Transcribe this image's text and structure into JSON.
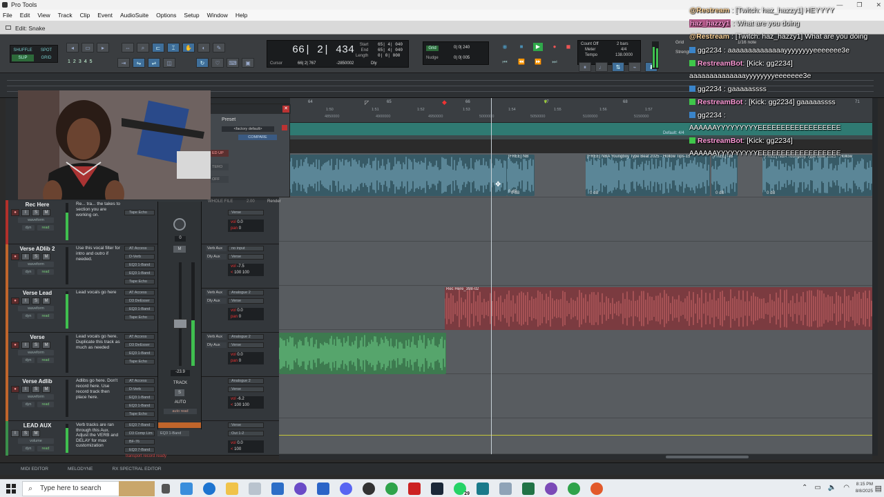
{
  "window": {
    "title": "Pro Tools",
    "controls": [
      "—",
      "❐",
      "✕"
    ]
  },
  "menu": [
    "File",
    "Edit",
    "View",
    "Track",
    "Clip",
    "Event",
    "AudioSuite",
    "Options",
    "Setup",
    "Window",
    "Help"
  ],
  "edit_window": {
    "title": "Edit: Snake"
  },
  "toolbar": {
    "modes": {
      "shuffle": "SHUFFLE",
      "spot": "SPOT",
      "slip": "SLIP",
      "grid": "GRID"
    },
    "zoom_presets": [
      "1",
      "2",
      "3",
      "4",
      "5"
    ],
    "counter": {
      "main": "66| 2| 434",
      "labels": [
        "Start",
        "End",
        "Length"
      ],
      "start": "65| 4| 040",
      "end": "65| 4| 040",
      "length": "0| 0| 000",
      "cursor_label": "Cursor",
      "cursor_value": "66| 2| 767",
      "sample_value": "-2850002",
      "dly": "Dly"
    },
    "grid": {
      "label": "Grid",
      "value": "0| 0| 240",
      "nudge_label": "Nudge",
      "nudge_value": "0| 0| 005"
    },
    "meter": {
      "count_off": "Count Off",
      "meter_label": "Meter",
      "tempo_label": "Tempo",
      "bars": "2 bars",
      "meter": "4/4",
      "tempo": "138.0000"
    },
    "grid_right": "Grid",
    "grid_right2": "Strengt",
    "note_value": "1/16 note"
  },
  "ruler": {
    "bars": [
      "64",
      "65",
      "66",
      "67",
      "68",
      "71"
    ],
    "times": [
      "1:50",
      "1:51",
      "1:52",
      "1:53",
      "1:54",
      "1:55",
      "1:56",
      "1:57"
    ],
    "samples": [
      "4850000",
      "4900000",
      "4950000",
      "5000000",
      "5050000",
      "5100000",
      "5150000"
    ],
    "meter_default": "Default: 4/4"
  },
  "preset": {
    "title": "Preset",
    "factory": "<factory default>",
    "compare": "COMPARE",
    "buttons": [
      "ED UP",
      "TERO",
      "OFF"
    ],
    "whole_file": "WHOLE FILE",
    "value": "2.00",
    "render": "Render"
  },
  "clips": {
    "top_1": "[FREE] NB",
    "top_2": "[FREE] NBA Youngboy Type Beat 2025 - Hollow Tips-15",
    "top_3": "[FREE] NB",
    "top_4": "[FREE] NBA Youngboy Type Beat 2025 - Hollow",
    "db": "0 dB",
    "rec_here": "Rec Here_398-02"
  },
  "tracks": [
    {
      "name": "Rec Here",
      "mode": "waveform",
      "comment": "Re... tra... the takes to section you are working on.",
      "inserts": [
        "Tape Echo"
      ],
      "io": [
        "Verse"
      ],
      "vol": "0.0",
      "pan": "0",
      "color": "#c0392b"
    },
    {
      "name": "Verse ADlib 2",
      "mode": "waveform",
      "comment": "Use this vocal filter for intro and outro if needed.",
      "inserts": [
        "AT Access",
        "D-Verb",
        "EQ3 1-Band",
        "EQ3 1-Band",
        "Tape Echo"
      ],
      "io": [
        "no input",
        "Verse"
      ],
      "vol": "-7.5",
      "pan": "100",
      "pan2": "100",
      "color": "#c0652b"
    },
    {
      "name": "Verse Lead",
      "mode": "waveform",
      "comment": "Lead vocals go here",
      "inserts": [
        "AT Access",
        "D3 DeEsser",
        "EQ3 1-Band",
        "Tape Echo"
      ],
      "io": [
        "Analogue 2",
        "Verse"
      ],
      "vol": "0.0",
      "pan": "0",
      "color": "#c0652b"
    },
    {
      "name": "Verse",
      "mode": "waveform",
      "comment": "Lead vocals go here. Duplicate this track as much as needed",
      "inserts": [
        "AT Access",
        "D3 DeEsser",
        "EQ3 1-Band",
        "Tape Echo"
      ],
      "io": [
        "Analogue 2",
        "Verse"
      ],
      "vol": "0.0",
      "pan": "0",
      "color": "#c0652b"
    },
    {
      "name": "Verse Adlib",
      "mode": "waveform",
      "comment": "Adlibs go here. Don't record here. Use record track then place here.",
      "inserts": [
        "AT Access",
        "D-Verb",
        "EQ3 1-Band",
        "EQ3 1-Band",
        "Tape Echo"
      ],
      "io": [
        "Analogue 2",
        "Verse"
      ],
      "vol": "-6.2",
      "pan": "100",
      "pan2": "100",
      "color": "#c0652b"
    },
    {
      "name": "LEAD AUX",
      "mode": "volume",
      "comment": "Verb tracks are ran through this Aux. Adjust the VERB and DELAY for max customization",
      "inserts": [
        "EQ3 7-Band",
        "D3 Comp Lim",
        "BF-76",
        "EQ3 7-Band"
      ],
      "io": [
        "Verse",
        "Out 1-2"
      ],
      "vol": "0.0",
      "pan": "100",
      "color": "#3a8f4a"
    }
  ],
  "track_buttons": {
    "rec": "●",
    "input": "I",
    "solo": "S",
    "mute": "M"
  },
  "track_sub": {
    "dyn": "dyn",
    "read": "read"
  },
  "sends": [
    "Verb Aux",
    "Dly Aux"
  ],
  "mixer": {
    "level": "0",
    "fader_value": "-23.9",
    "track_label": "TRACK",
    "solo": "S",
    "auto_label": "AUTO",
    "auto_mode": "auto read",
    "mute": "M",
    "eq_insert": "EQ3 1-Band"
  },
  "status": {
    "transport_text": "transport record ready"
  },
  "bottom_tabs": [
    "MIDI EDITOR",
    "MELODYNE",
    "RX SPECTRAL EDITOR"
  ],
  "chat": [
    {
      "user": "@Restream",
      "text": " : [Twitch: haz_hazzy1] HEYYYY",
      "platform": "none",
      "color": "uname"
    },
    {
      "user": "haz_hazzy1",
      "text": " : What are you doing",
      "platform": "none",
      "color": "uname2"
    },
    {
      "user": "@Restream",
      "text": " : [Twitch: haz_hazzy1] What are you doing",
      "platform": "none",
      "color": "uname"
    },
    {
      "user": "gg2234",
      "text": " : aaaaaaaaaaaaaayyyyyyyyeeeeeee3e",
      "platform": "twitch",
      "color": "plain"
    },
    {
      "user": "RestreamBot",
      "text": ": [Kick: gg2234]",
      "platform": "kick",
      "color": "uname2"
    },
    {
      "user": "",
      "text": "aaaaaaaaaaaaaayyyyyyyyeeeeeee3e",
      "platform": "none",
      "color": "plain"
    },
    {
      "user": "gg2234",
      "text": " : gaaaaassss",
      "platform": "twitch",
      "color": "plain"
    },
    {
      "user": "RestreamBot",
      "text": " : [Kick: gg2234] gaaaaassss",
      "platform": "kick",
      "color": "uname2"
    },
    {
      "user": "gg2234",
      "text": " :",
      "platform": "twitch",
      "color": "plain"
    },
    {
      "user": "",
      "text": "AAAAAAYYYYYYYYYEEEEEEEEEEEEEEEEEE",
      "platform": "none",
      "color": "plain"
    },
    {
      "user": "RestreamBot",
      "text": ": [Kick: gg2234]",
      "platform": "kick",
      "color": "uname2"
    },
    {
      "user": "",
      "text": "AAAAAAYYYYYYYYYEEEEEEEEEEEEEEEEEE",
      "platform": "none",
      "color": "plain"
    }
  ],
  "taskbar": {
    "search_placeholder": "Type here to search",
    "time": "8:15 PM",
    "date": "8/8/2025",
    "badge": "29"
  },
  "colors": {
    "teal": "#2f7a72",
    "wave_blue": "#7fb3c8",
    "wave_red": "#d16a6a",
    "wave_green": "#6fd08a",
    "clip_red": "#8a3a3e",
    "clip_green": "#3f7a4e"
  }
}
